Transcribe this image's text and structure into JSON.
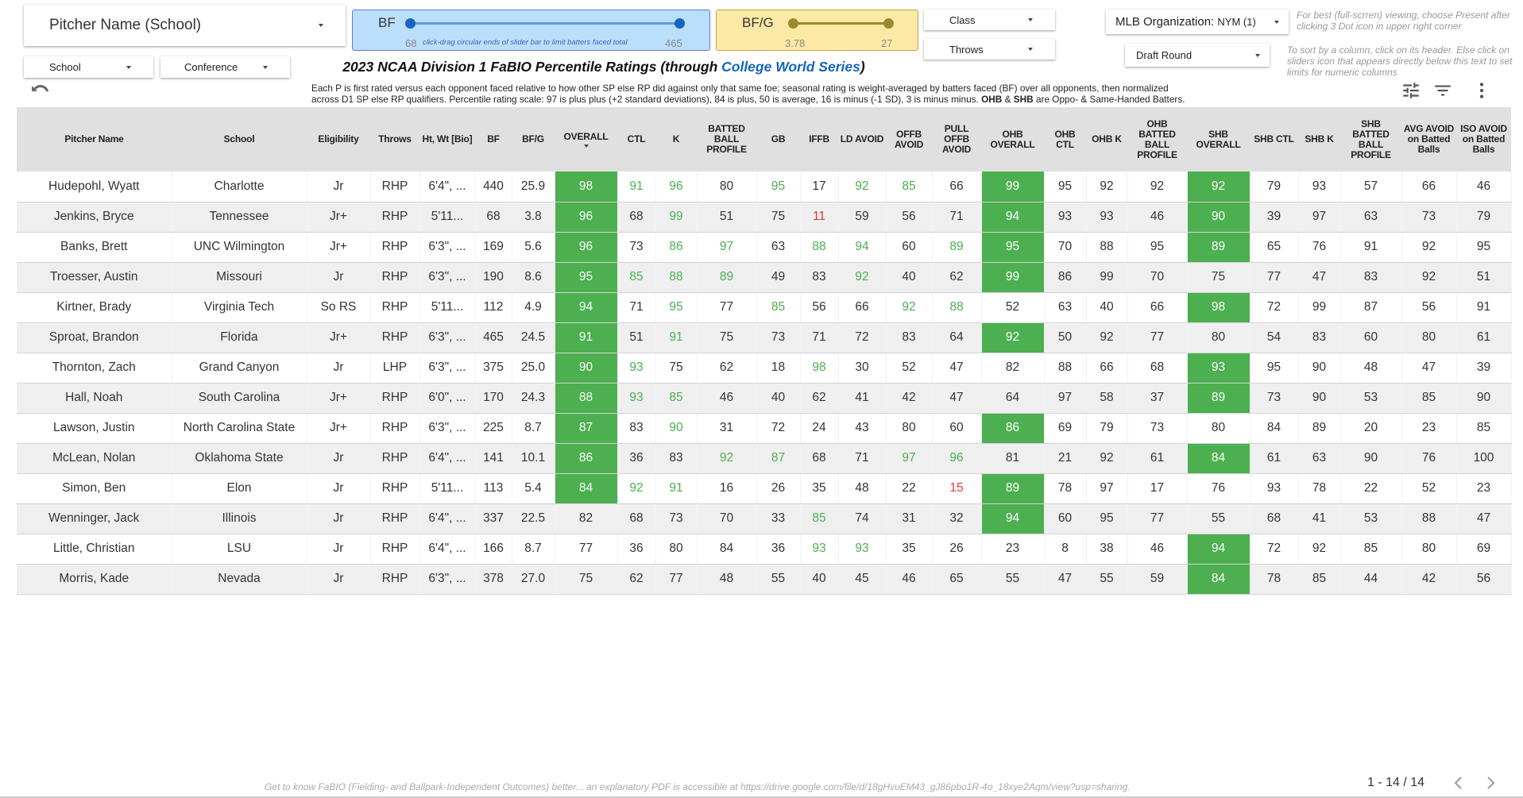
{
  "filters": {
    "pitcher_name": "Pitcher Name (School)",
    "school": "School",
    "conference": "Conference",
    "class": "Class",
    "throws": "Throws",
    "mlb_org_label": "MLB Organization:",
    "mlb_org_value": "NYM  (1)",
    "draft_round": "Draft Round"
  },
  "sliders": {
    "bf": {
      "label": "BF",
      "min": "68",
      "max": "465",
      "hint": "click-drag circular ends of slider bar to limit batters faced total",
      "color": "#1565c0"
    },
    "bfg": {
      "label": "BF/G",
      "min": "3.78",
      "max": "27",
      "color": "#9a8a2a"
    }
  },
  "notes": {
    "present": "For best (full-scrren) viewing, choose Present after clicking 3 Dot icon in upper right corner",
    "sort": "To sort by a column, click on its header. Else click on sliders icon that appears directly below this text to set limits for numeric columns"
  },
  "title": {
    "prefix": "2023 NCAA Division 1 FaBIO Percentile Ratings (through ",
    "link": "College World Series",
    "suffix": ")"
  },
  "description": {
    "line1": "Each P is first rated versus each opponent faced relative to how other SP else RP did against only that same foe; seasonal rating is weight-averaged by batters faced (BF) over all opponents, then normalized",
    "line2": "across D1 SP else RP qualifiers. Percentile rating scale: 97 is plus plus (+2 standard deviations), 84 is plus, 50 is average, 16 is minus (-1 SD), 3 is minus minus. ",
    "ohb": "OHB",
    "amp": " & ",
    "shb": "SHB",
    "tail": " are Oppo- & Same-Handed Batters."
  },
  "icons": {
    "undo": "undo-icon",
    "tune": "tune-icon",
    "filter": "filter-icon",
    "more": "more-vert-icon"
  },
  "colors": {
    "highlight": "#4caf50",
    "good_text": "#4caf50",
    "bad_text": "#e53935",
    "header_bg": "#e0e0e0"
  },
  "table": {
    "columns": [
      "Pitcher Name",
      "School",
      "Eligibility",
      "Throws",
      "Ht, Wt [Bio]",
      "BF",
      "BF/G",
      "OVERALL",
      "CTL",
      "K",
      "BATTED BALL PROFILE",
      "GB",
      "IFFB",
      "LD AVOID",
      "OFFB AVOID",
      "PULL OFFB AVOID",
      "OHB OVERALL",
      "OHB CTL",
      "OHB K",
      "OHB BATTED BALL PROFILE",
      "SHB OVERALL",
      "SHB CTL",
      "SHB K",
      "SHB BATTED BALL PROFILE",
      "AVG AVOID on Batted Balls",
      "ISO AVOID on Batted Balls"
    ],
    "sorted_column": "OVERALL",
    "rows": [
      [
        "Hudepohl, Wyatt",
        "Charlotte",
        "Jr",
        "RHP",
        "6'4\", ...",
        "440",
        "25.9",
        "98",
        "91",
        "96",
        "80",
        "95",
        "17",
        "92",
        "85",
        "66",
        "99",
        "95",
        "92",
        "92",
        "92",
        "79",
        "93",
        "57",
        "66",
        "46"
      ],
      [
        "Jenkins, Bryce",
        "Tennessee",
        "Jr+",
        "RHP",
        "5'11...",
        "68",
        "3.8",
        "96",
        "68",
        "99",
        "51",
        "75",
        "11",
        "59",
        "56",
        "71",
        "94",
        "93",
        "93",
        "46",
        "90",
        "39",
        "97",
        "63",
        "73",
        "79"
      ],
      [
        "Banks, Brett",
        "UNC Wilmington",
        "Jr+",
        "RHP",
        "6'3\", ...",
        "169",
        "5.6",
        "96",
        "73",
        "86",
        "97",
        "63",
        "88",
        "94",
        "60",
        "89",
        "95",
        "70",
        "88",
        "95",
        "89",
        "65",
        "76",
        "91",
        "92",
        "95"
      ],
      [
        "Troesser, Austin",
        "Missouri",
        "Jr",
        "RHP",
        "6'3\", ...",
        "190",
        "8.6",
        "95",
        "85",
        "88",
        "89",
        "49",
        "83",
        "92",
        "40",
        "62",
        "99",
        "86",
        "99",
        "70",
        "75",
        "77",
        "47",
        "83",
        "92",
        "51"
      ],
      [
        "Kirtner, Brady",
        "Virginia Tech",
        "So RS",
        "RHP",
        "5'11...",
        "112",
        "4.9",
        "94",
        "71",
        "95",
        "77",
        "85",
        "56",
        "66",
        "92",
        "88",
        "52",
        "63",
        "40",
        "66",
        "98",
        "72",
        "99",
        "87",
        "56",
        "91"
      ],
      [
        "Sproat, Brandon",
        "Florida",
        "Jr+",
        "RHP",
        "6'3\", ...",
        "465",
        "24.5",
        "91",
        "51",
        "91",
        "75",
        "73",
        "71",
        "72",
        "83",
        "64",
        "92",
        "50",
        "92",
        "77",
        "80",
        "54",
        "83",
        "60",
        "80",
        "61"
      ],
      [
        "Thornton, Zach",
        "Grand Canyon",
        "Jr",
        "LHP",
        "6'3\", ...",
        "375",
        "25.0",
        "90",
        "93",
        "75",
        "62",
        "18",
        "98",
        "30",
        "52",
        "47",
        "82",
        "88",
        "66",
        "68",
        "93",
        "95",
        "90",
        "48",
        "47",
        "39"
      ],
      [
        "Hall, Noah",
        "South Carolina",
        "Jr+",
        "RHP",
        "6'0\", ...",
        "170",
        "24.3",
        "88",
        "93",
        "85",
        "46",
        "40",
        "62",
        "41",
        "42",
        "47",
        "64",
        "97",
        "58",
        "37",
        "89",
        "73",
        "90",
        "53",
        "85",
        "90"
      ],
      [
        "Lawson, Justin",
        "North Carolina State",
        "Jr+",
        "RHP",
        "6'3\", ...",
        "225",
        "8.7",
        "87",
        "83",
        "90",
        "31",
        "72",
        "24",
        "43",
        "80",
        "60",
        "86",
        "69",
        "79",
        "73",
        "80",
        "84",
        "89",
        "20",
        "23",
        "85"
      ],
      [
        "McLean, Nolan",
        "Oklahoma State",
        "Jr",
        "RHP",
        "6'4\", ...",
        "141",
        "10.1",
        "86",
        "36",
        "83",
        "92",
        "87",
        "68",
        "71",
        "97",
        "96",
        "81",
        "21",
        "92",
        "61",
        "84",
        "61",
        "63",
        "90",
        "76",
        "100"
      ],
      [
        "Simon, Ben",
        "Elon",
        "Jr",
        "RHP",
        "5'11...",
        "113",
        "5.4",
        "84",
        "92",
        "91",
        "16",
        "26",
        "35",
        "48",
        "22",
        "15",
        "89",
        "78",
        "97",
        "17",
        "76",
        "93",
        "78",
        "22",
        "52",
        "23"
      ],
      [
        "Wenninger, Jack",
        "Illinois",
        "Jr",
        "RHP",
        "6'4\", ...",
        "337",
        "22.5",
        "82",
        "68",
        "73",
        "70",
        "33",
        "85",
        "74",
        "31",
        "32",
        "94",
        "60",
        "95",
        "77",
        "55",
        "68",
        "41",
        "53",
        "88",
        "47"
      ],
      [
        "Little, Christian",
        "LSU",
        "Jr",
        "RHP",
        "6'4\", ...",
        "166",
        "8.7",
        "77",
        "36",
        "80",
        "84",
        "36",
        "93",
        "93",
        "35",
        "26",
        "23",
        "8",
        "38",
        "46",
        "94",
        "72",
        "92",
        "85",
        "80",
        "69"
      ],
      [
        "Morris, Kade",
        "Nevada",
        "Jr",
        "RHP",
        "6'3\", ...",
        "378",
        "27.0",
        "75",
        "62",
        "77",
        "48",
        "55",
        "40",
        "45",
        "46",
        "65",
        "55",
        "47",
        "55",
        "59",
        "84",
        "78",
        "85",
        "44",
        "42",
        "56"
      ]
    ],
    "styles": [
      "..........hgghgg.h....h.....",
      "........h..r.....h...h......",
      "........h.gghg.gh...h.......",
      "........hggg..g..h..........",
      "........h.g..g..gg....h.....",
      "........h.g......h..........",
      "........hg.....g.....h......",
      "........hgg..........h......",
      "........h.g......h..........",
      "........h...gg..gg....h.....",
      "........hgg.....rh..........",
      "..............g..h..........",
      "..............gg.......h....",
      "..........................."
    ]
  },
  "footer": {
    "note": "Get to know FaBIO (Fielding- and Ballpark-Independent Outcomes) better... an explanatory PDF is accessible at  https://drive.google.com/file/d/18gHvuEM43_gJ86pbo1R-4o_18xye2Aqm/view?usp=sharing.",
    "pager": "1 - 14 / 14"
  }
}
